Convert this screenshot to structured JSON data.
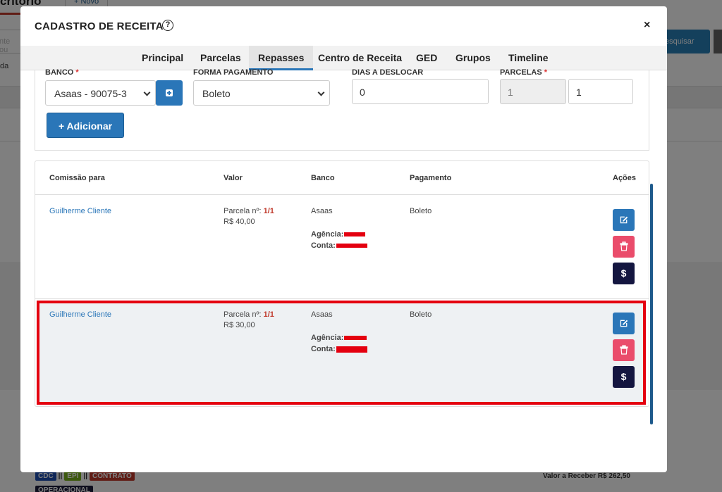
{
  "background": {
    "active_tab": "critorio",
    "new_tab": "+ Novo",
    "input_placeholder": "nte ou",
    "label_partial": "da",
    "search_button": "esquisar",
    "badges": [
      "CDC",
      "EPI",
      "CONTRATO"
    ],
    "separator": "||",
    "badge_operacional": "OPERACIONAL",
    "valor_receber": "Valor a Receber R$ 262,50"
  },
  "modal": {
    "title": "CADASTRO DE RECEITA",
    "help_icon": "?",
    "close_icon": "×",
    "tabs": [
      {
        "label": "Principal"
      },
      {
        "label": "Parcelas"
      },
      {
        "label": "Repasses"
      },
      {
        "label": "Centro de Receita"
      },
      {
        "label": "GED"
      },
      {
        "label": "Grupos"
      },
      {
        "label": "Timeline"
      }
    ],
    "active_tab": "Repasses",
    "form": {
      "banco_label": "BANCO",
      "banco_value": "Asaas - 90075-3",
      "forma_label": "FORMA PAGAMENTO",
      "forma_value": "Boleto",
      "dias_label": "DIAS A DESLOCAR",
      "dias_value": "0",
      "parcelas_label": "PARCELAS",
      "parcelas_value_disabled": "1",
      "parcelas_value": "1",
      "required_mark": "*",
      "add_button": "+ Adicionar"
    },
    "table": {
      "headers": {
        "comissao": "Comissão para",
        "valor": "Valor",
        "banco": "Banco",
        "pagamento": "Pagamento",
        "acoes": "Ações"
      },
      "rows": [
        {
          "comissao": "Guilherme Cliente",
          "parcela_label": "Parcela nº:",
          "parcela_num": "1/1",
          "valor": "R$ 40,00",
          "banco": "Asaas",
          "agencia_label": "Agência:",
          "conta_label": "Conta:",
          "pagamento": "Boleto",
          "pay_icon": "$"
        },
        {
          "comissao": "Guilherme Cliente",
          "parcela_label": "Parcela nº:",
          "parcela_num": "1/1",
          "valor": "R$ 30,00",
          "banco": "Asaas",
          "agencia_label": "Agência:",
          "conta_label": "Conta:",
          "pagamento": "Boleto",
          "pay_icon": "$"
        }
      ]
    }
  },
  "colors": {
    "primary": "#2a76b8",
    "danger": "#ea4c6b",
    "dark": "#141640",
    "highlight": "#e4000f"
  }
}
